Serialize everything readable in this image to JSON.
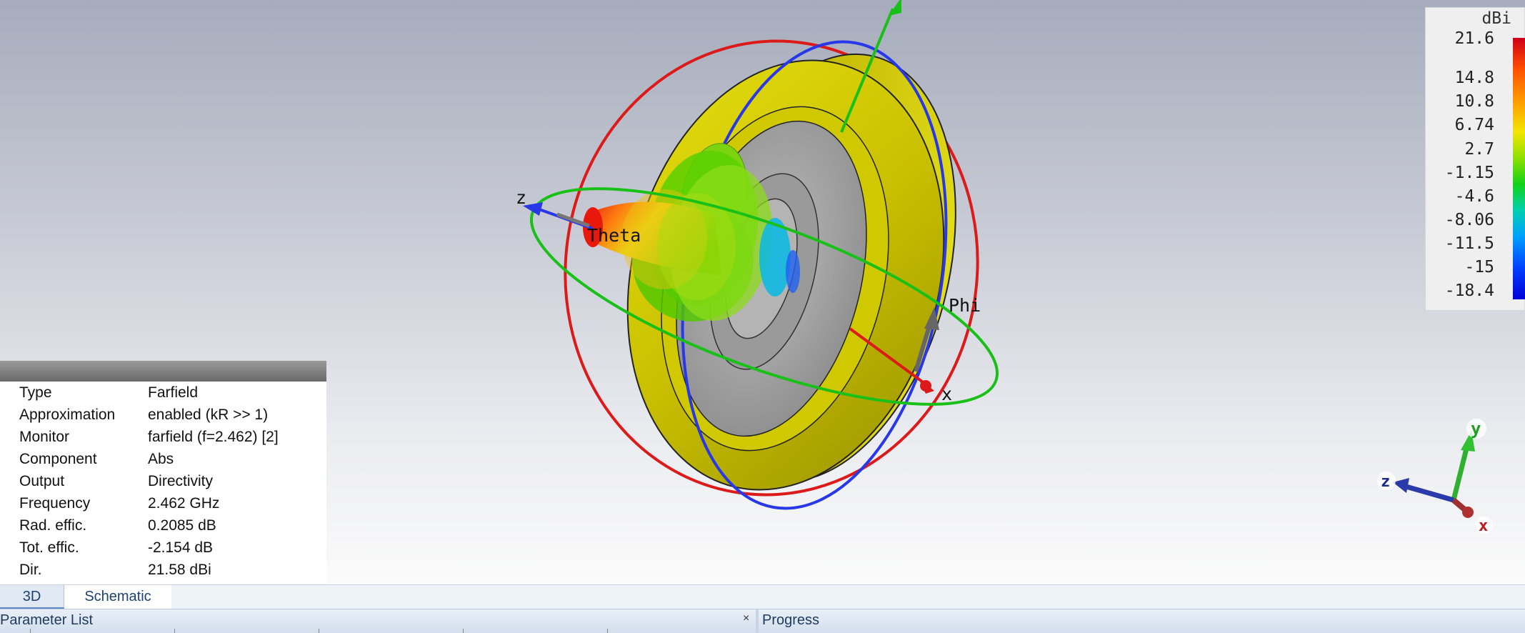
{
  "scene": {
    "label_theta": "Theta",
    "label_phi": "Phi",
    "label_x": "x",
    "label_z": "z"
  },
  "legend": {
    "unit": "dBi",
    "ticks": [
      "21.6",
      "14.8",
      "10.8",
      "6.74",
      "2.7",
      "-1.15",
      "-4.6",
      "-8.06",
      "-11.5",
      "-15",
      "-18.4"
    ],
    "colors": [
      "#d0001a",
      "#ff5000",
      "#ff9a00",
      "#f2e600",
      "#8ee000",
      "#12d21a",
      "#00d0b0",
      "#00a0ff",
      "#0040ff",
      "#0000d8"
    ]
  },
  "properties": [
    {
      "key": "Type",
      "value": "Farfield"
    },
    {
      "key": "Approximation",
      "value": "enabled (kR >> 1)"
    },
    {
      "key": "Monitor",
      "value": "farfield (f=2.462) [2]"
    },
    {
      "key": "Component",
      "value": "Abs"
    },
    {
      "key": "Output",
      "value": "Directivity"
    },
    {
      "key": "Frequency",
      "value": "2.462 GHz"
    },
    {
      "key": "Rad. effic.",
      "value": "0.2085 dB"
    },
    {
      "key": "Tot. effic.",
      "value": "-2.154 dB"
    },
    {
      "key": "Dir.",
      "value": "21.58 dBi"
    }
  ],
  "axes_widget": {
    "x": "x",
    "y": "y",
    "z": "z"
  },
  "view_tabs": {
    "tab_3d": "3D",
    "tab_schematic": "Schematic"
  },
  "panels": {
    "parameter_list": "Parameter List",
    "close": "×",
    "progress": "Progress"
  }
}
